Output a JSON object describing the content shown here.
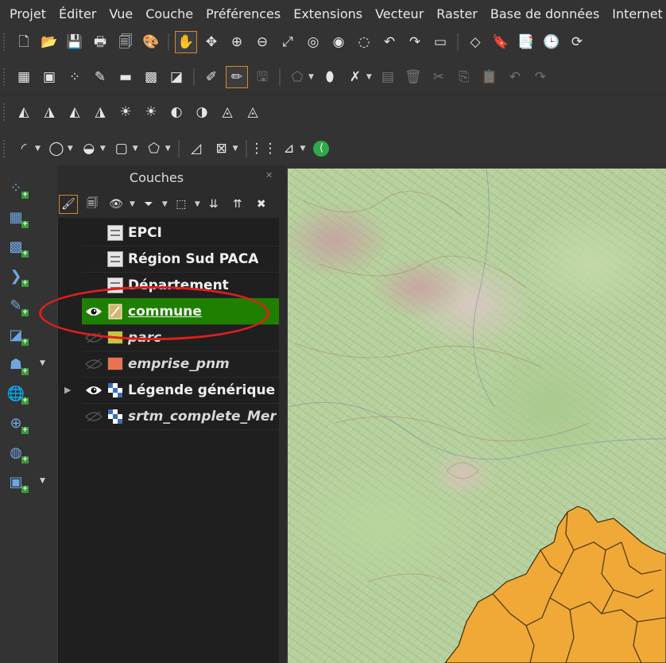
{
  "menubar": {
    "items": [
      "Projet",
      "Éditer",
      "Vue",
      "Couche",
      "Préférences",
      "Extensions",
      "Vecteur",
      "Raster",
      "Base de données",
      "Internet"
    ]
  },
  "toolbars": {
    "row1": [
      {
        "icon": "new-project-icon",
        "glyph": "🗋"
      },
      {
        "icon": "open-project-icon",
        "glyph": "📂"
      },
      {
        "icon": "save-project-icon",
        "glyph": "💾"
      },
      {
        "icon": "print-layout-icon",
        "glyph": "🖶"
      },
      {
        "icon": "layout-manager-icon",
        "glyph": "🗐"
      },
      {
        "icon": "style-manager-icon",
        "glyph": "🎨"
      },
      {
        "icon": "pan-hand-icon",
        "glyph": "✋",
        "active": true
      },
      {
        "icon": "pan-to-selection-icon",
        "glyph": "✥"
      },
      {
        "icon": "zoom-in-icon",
        "glyph": "⊕"
      },
      {
        "icon": "zoom-out-icon",
        "glyph": "⊖"
      },
      {
        "icon": "zoom-full-icon",
        "glyph": "⤢"
      },
      {
        "icon": "zoom-to-selection-icon",
        "glyph": "◎"
      },
      {
        "icon": "zoom-to-layer-icon",
        "glyph": "◉"
      },
      {
        "icon": "zoom-native-icon",
        "glyph": "◌"
      },
      {
        "icon": "zoom-last-icon",
        "glyph": "↶"
      },
      {
        "icon": "zoom-next-icon",
        "glyph": "↷"
      },
      {
        "icon": "new-map-view-icon",
        "glyph": "▭"
      },
      {
        "icon": "new-3d-view-icon",
        "glyph": "◇"
      },
      {
        "icon": "spatial-bookmark-icon",
        "glyph": "🔖"
      },
      {
        "icon": "bookmarks-icon",
        "glyph": "📑"
      },
      {
        "icon": "temporal-controller-icon",
        "glyph": "🕒"
      },
      {
        "icon": "refresh-icon",
        "glyph": "⟳"
      }
    ],
    "row2": [
      {
        "icon": "data-source-manager-icon",
        "glyph": "▦"
      },
      {
        "icon": "new-geopackage-layer-icon",
        "glyph": "▣"
      },
      {
        "icon": "new-shapefile-layer-icon",
        "glyph": "⁘"
      },
      {
        "icon": "new-temporary-layer-icon",
        "glyph": "✎"
      },
      {
        "icon": "new-spatialite-layer-icon",
        "glyph": "▬"
      },
      {
        "icon": "new-virtual-layer-icon",
        "glyph": "▩"
      },
      {
        "icon": "new-mesh-layer-icon",
        "glyph": "◪"
      },
      {
        "icon": "current-edits-icon",
        "glyph": "✐"
      },
      {
        "icon": "toggle-editing-icon",
        "glyph": "✏",
        "active": true
      },
      {
        "icon": "save-edits-icon",
        "glyph": "🖫",
        "dim": true
      },
      {
        "icon": "digitize-polygon-icon",
        "glyph": "⬠",
        "dim": true,
        "dropdown": true
      },
      {
        "icon": "vertex-tool-icon",
        "glyph": "⬮",
        "dropdown": false
      },
      {
        "icon": "feature-tool-icon",
        "glyph": "✗",
        "dropdown": true
      },
      {
        "icon": "modify-attributes-icon",
        "glyph": "▤",
        "dim": true
      },
      {
        "icon": "delete-selected-icon",
        "glyph": "🗑",
        "dim": true
      },
      {
        "icon": "cut-features-icon",
        "glyph": "✂",
        "dim": true
      },
      {
        "icon": "copy-features-icon",
        "glyph": "⎘",
        "dim": true
      },
      {
        "icon": "paste-features-icon",
        "glyph": "📋",
        "dim": true
      },
      {
        "icon": "undo-icon",
        "glyph": "↶",
        "dim": true
      },
      {
        "icon": "redo-icon",
        "glyph": "↷",
        "dim": true
      }
    ],
    "row3": [
      {
        "icon": "label-tool-1-icon",
        "glyph": "◭"
      },
      {
        "icon": "label-tool-2-icon",
        "glyph": "◮"
      },
      {
        "icon": "label-tool-3-icon",
        "glyph": "◭"
      },
      {
        "icon": "label-tool-4-icon",
        "glyph": "◮"
      },
      {
        "icon": "label-tool-5-icon",
        "glyph": "☀"
      },
      {
        "icon": "label-tool-6-icon",
        "glyph": "☀"
      },
      {
        "icon": "label-tool-7-icon",
        "glyph": "◐"
      },
      {
        "icon": "label-tool-8-icon",
        "glyph": "◑"
      },
      {
        "icon": "label-tool-9-icon",
        "glyph": "◬"
      },
      {
        "icon": "label-tool-10-icon",
        "glyph": "◬"
      }
    ],
    "row4": [
      {
        "icon": "measure-tool-icon",
        "glyph": "◜",
        "dropdown": true
      },
      {
        "icon": "select-features-icon",
        "glyph": "◯",
        "dropdown": true
      },
      {
        "icon": "identify-icon",
        "glyph": "◒",
        "dropdown": true
      },
      {
        "icon": "select-by-value-icon",
        "glyph": "▢",
        "dropdown": true
      },
      {
        "icon": "polygon-select-icon",
        "glyph": "⬠",
        "dropdown": true
      },
      {
        "icon": "annotation-tool-icon",
        "glyph": "◿"
      },
      {
        "icon": "text-annotation-icon",
        "glyph": "⊠",
        "dropdown": true
      },
      {
        "icon": "layer-tool-1-icon",
        "glyph": "⋮⋮"
      },
      {
        "icon": "layer-tool-2-icon",
        "glyph": "⊿",
        "dropdown": true
      },
      {
        "icon": "share-icon",
        "glyph": "⟨",
        "green": true
      }
    ]
  },
  "left_toolbar": [
    {
      "icon": "add-delimited-text-icon",
      "glyph": "⁘"
    },
    {
      "icon": "add-raster-layer-icon",
      "glyph": "▦"
    },
    {
      "icon": "add-mesh-layer-icon",
      "glyph": "▩"
    },
    {
      "icon": "add-virtual-layer-icon",
      "glyph": "❯"
    },
    {
      "icon": "add-vector-layer-icon",
      "glyph": "✎"
    },
    {
      "icon": "add-gpx-layer-icon",
      "glyph": "◪"
    },
    {
      "icon": "add-postgis-layer-icon",
      "glyph": "☗",
      "dropdown": true
    },
    {
      "icon": "add-wms-layer-icon",
      "glyph": "🌐"
    },
    {
      "icon": "add-wfs-layer-icon",
      "glyph": "⊕"
    },
    {
      "icon": "add-xyz-layer-icon",
      "glyph": "◍"
    },
    {
      "icon": "add-geopackage-layer-icon",
      "glyph": "▣",
      "dropdown": true
    }
  ],
  "layers_panel": {
    "title": "Couches",
    "toolbar_icons": [
      {
        "icon": "style-panel-icon",
        "glyph": "🖌",
        "active": true
      },
      {
        "icon": "add-group-icon",
        "glyph": "🗐"
      },
      {
        "icon": "manage-visibility-icon",
        "glyph": "👁",
        "dropdown": true
      },
      {
        "icon": "filter-legend-icon",
        "glyph": "⏷",
        "dropdown": true
      },
      {
        "icon": "filter-by-expression-icon",
        "glyph": "⬚",
        "dropdown": true
      },
      {
        "icon": "expand-all-icon",
        "glyph": "⇊"
      },
      {
        "icon": "collapse-all-icon",
        "glyph": "⇈"
      },
      {
        "icon": "remove-layer-icon",
        "glyph": "✖"
      }
    ],
    "layers": [
      {
        "name": "EPCI",
        "type": "table",
        "visible": null,
        "italic": false,
        "selected": false,
        "expander": false
      },
      {
        "name": "Région Sud PACA",
        "type": "table",
        "visible": null,
        "italic": false,
        "selected": false,
        "expander": false
      },
      {
        "name": "Département",
        "type": "table",
        "visible": null,
        "italic": false,
        "selected": false,
        "expander": false
      },
      {
        "name": "commune",
        "type": "editing",
        "visible": true,
        "italic": false,
        "selected": true,
        "expander": false,
        "underline": true
      },
      {
        "name": "parc",
        "type": "swatch",
        "color": "#c8c43c",
        "visible": false,
        "italic": true,
        "selected": false,
        "expander": false
      },
      {
        "name": "emprise_pnm",
        "type": "swatch",
        "color": "#e8734e",
        "visible": false,
        "italic": true,
        "selected": false,
        "expander": false
      },
      {
        "name": "Légende générique",
        "type": "raster",
        "visible": true,
        "italic": false,
        "selected": false,
        "expander": true
      },
      {
        "name": "srtm_complete_Mer",
        "type": "raster",
        "visible": false,
        "italic": true,
        "selected": false,
        "expander": false
      }
    ]
  },
  "colors": {
    "selection_green": "#1f7f00",
    "highlight_red": "#e01e1e",
    "commune_fill": "#f0a836",
    "active_border": "#d08a2c"
  }
}
